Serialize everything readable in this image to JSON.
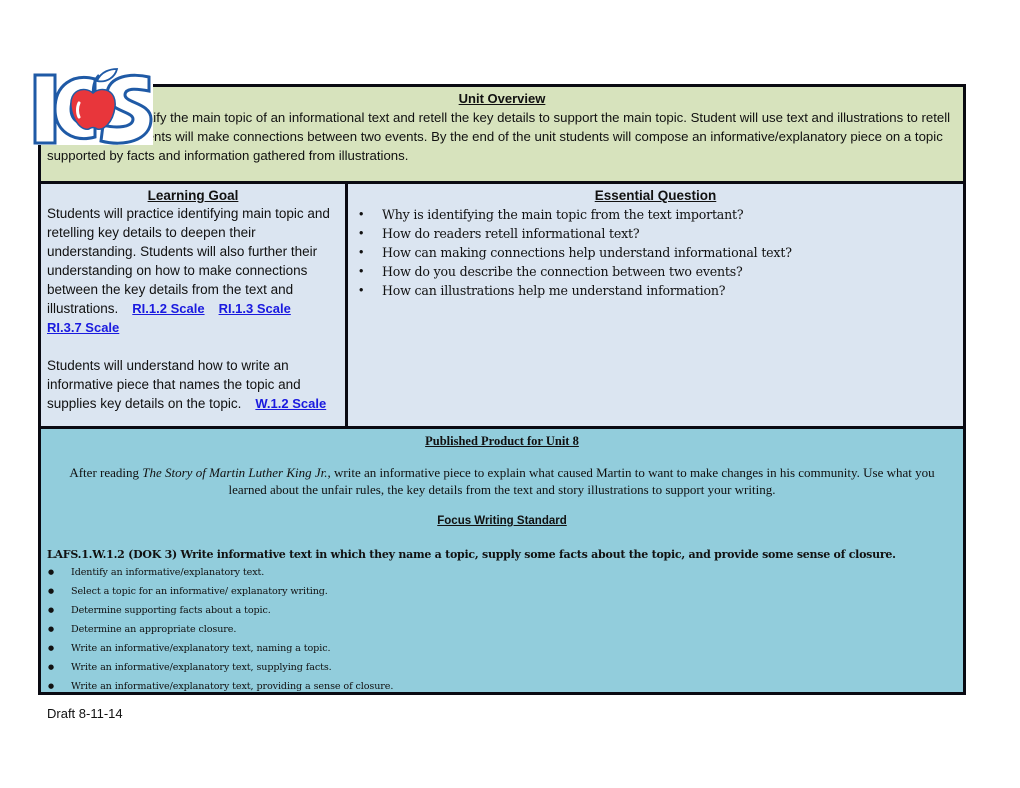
{
  "overview": {
    "title": "Unit Overview",
    "text": "Students will identify the main topic of an informational text and retell the key details to support the main topic.  Student will use text and illustrations to retell information.  Students will make connections between two events.  By the end of the unit students will compose an informative/explanatory piece on a topic supported by facts and information gathered from illustrations."
  },
  "learning_goal": {
    "title": "Learning Goal",
    "paragraph1": "Students will practice identifying main topic and retelling key details to deepen their understanding. Students will also further their understanding on how to make connections between the key details from the text and illustrations.",
    "links1": [
      "RI.1.2 Scale",
      "RI.1.3 Scale",
      "RI.3.7 Scale"
    ],
    "paragraph2": "Students will understand how to write an informative piece that names the topic and supplies key details on the topic.",
    "link2": "W.1.2 Scale"
  },
  "essential_question": {
    "title": "Essential Question",
    "items": [
      "Why is identifying the main topic from the text important?",
      "How do readers retell informational text?",
      "How can making connections help understand informational text?",
      "How do you describe the connection between two events?",
      "How can illustrations help me understand information?"
    ]
  },
  "published_product": {
    "title": "Published Product for Unit 8",
    "intro": "After reading ",
    "book_title": "The Story of Martin Luther King Jr.,",
    "body": " write an informative piece to explain what caused Martin to want to make changes in his community. Use what you learned about the unfair rules, the key details from the text and story illustrations to support your writing."
  },
  "focus_writing": {
    "title": "Focus Writing Standard",
    "standard": "LAFS.1.W.1.2 (DOK 3) Write informative text in which they name a topic, supply some facts about the topic, and provide some sense of closure.",
    "items": [
      "Identify an informative/explanatory text.",
      "Select a topic for an informative/ explanatory writing.",
      "Determine supporting facts about a topic.",
      "Determine an appropriate closure.",
      "Write an informative/explanatory text, naming a topic.",
      "Write an informative/explanatory text, supplying facts.",
      "Write an informative/explanatory text, providing a sense of closure."
    ]
  },
  "logo": {
    "text": "ICS",
    "icon": "apple-icon"
  },
  "footer": {
    "draft": "Draft 8-11-14"
  },
  "colors": {
    "overview_bg": "#d7e3bd",
    "goal_bg": "#dbe5f1",
    "published_bg": "#92cddc",
    "link": "#1a1adf",
    "logo_blue": "#1f5aa6",
    "apple_red": "#e8363b"
  }
}
